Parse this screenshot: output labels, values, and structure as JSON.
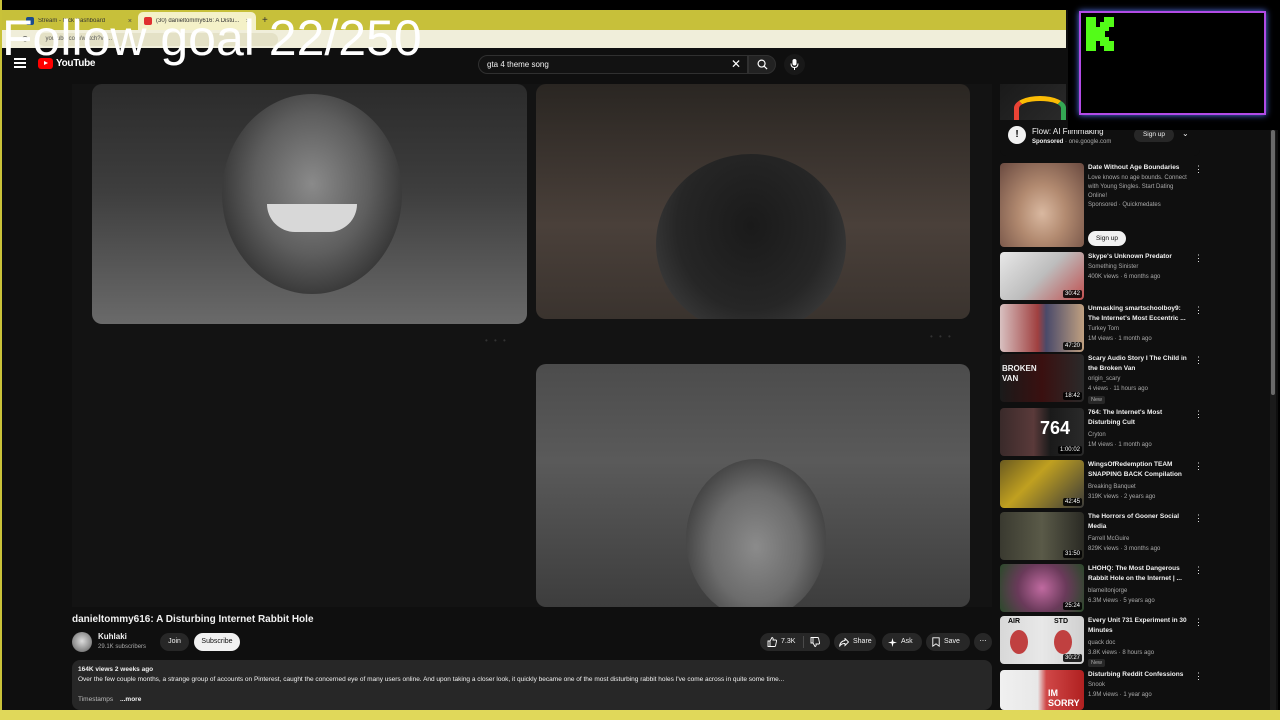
{
  "browser": {
    "tabs": [
      {
        "label": "Stream - Kick Dashboard",
        "close": "×"
      },
      {
        "label": "(30) danieltommy616: A Distu...",
        "close": "×"
      }
    ],
    "new_tab": "+",
    "url": "youtube.com/watch?v=..."
  },
  "overlay": {
    "follow_goal": "Follow goal 22/250",
    "kick_logo": "kick-logo"
  },
  "header": {
    "logo_text": "YouTube",
    "search_value": "gta 4 theme song",
    "clear": "✕"
  },
  "video": {
    "title": "danieltommy616: A Disturbing Internet Rabbit Hole",
    "channel": "Kuhlaki",
    "subscribers": "29.1K subscribers",
    "join": "Join",
    "subscribe": "Subscribe",
    "likes": "7.3K",
    "share": "Share",
    "ask": "Ask",
    "save": "Save",
    "more": "⋯",
    "stats": "164K views  2 weeks ago",
    "description": "Over the few couple months, a strange group of accounts on Pinterest, caught the concerned eye of many users online. And upon taking a closer look, it quickly became one of the most disturbing rabbit holes I've come across in quite some time...",
    "timestamps": "Timestamps",
    "more_link": "...more"
  },
  "ad": {
    "title": "Flow: AI Filmmaking",
    "sponsored": "Sponsored",
    "domain": "one.google.com",
    "cta": "Sign up",
    "chevron": "⌄"
  },
  "recommendations": [
    {
      "title": "Date Without Age Boundaries",
      "channel": "Love knows no age bounds. Connect with Young Singles. Start Dating Online!",
      "meta": "Sponsored · Quickmedates",
      "duration": "",
      "cta": "Sign up"
    },
    {
      "title": "Skype's Unknown Predator",
      "channel": "Something Sinister",
      "meta": "400K views · 6 months ago",
      "duration": "30:42"
    },
    {
      "title": "Unmasking smartschoolboy9: The Internet's Most Eccentric ...",
      "channel": "Turkey Tom",
      "meta": "1M views · 1 month ago",
      "duration": "47:20"
    },
    {
      "title": "Scary Audio Story I The Child in the Broken Van",
      "channel": "origin_scary",
      "meta": "4 views · 11 hours ago",
      "duration": "18:42",
      "badge": "New"
    },
    {
      "title": "764: The Internet's Most Disturbing Cult",
      "channel": "Cryton",
      "meta": "1M views · 1 month ago",
      "duration": "1:00:02"
    },
    {
      "title": "WingsOfRedemption TEAM SNAPPING BACK Compilation",
      "channel": "Breaking Banquet",
      "meta": "319K views · 2 years ago",
      "duration": "42:45"
    },
    {
      "title": "The Horrors of Gooner Social Media",
      "channel": "Farrell McGuire",
      "meta": "829K views · 3 months ago",
      "duration": "31:50"
    },
    {
      "title": "LHOHQ: The Most Dangerous Rabbit Hole on the Internet | ...",
      "channel": "blameitonjorge",
      "meta": "6.3M views · 5 years ago",
      "duration": "25:24"
    },
    {
      "title": "Every Unit 731 Experiment in 30 Minutes",
      "channel": "quack doc",
      "meta": "3.8K views · 8 hours ago",
      "duration": "30:27",
      "badge": "New"
    },
    {
      "title": "Disturbing Reddit Confessions",
      "channel": "Snook",
      "meta": "1.9M views · 1 year ago",
      "duration": ""
    }
  ],
  "thumb_text": {
    "broken_van": "BROKEN VAN",
    "num764": "764",
    "air": "AIR",
    "std": "STD",
    "im_sorry": "IM SORRY"
  },
  "colors": {
    "frame_yellow": "#c9c239",
    "kick_green": "#53fc18",
    "kick_border": "#b24be6",
    "yt_red": "#ff0000"
  }
}
